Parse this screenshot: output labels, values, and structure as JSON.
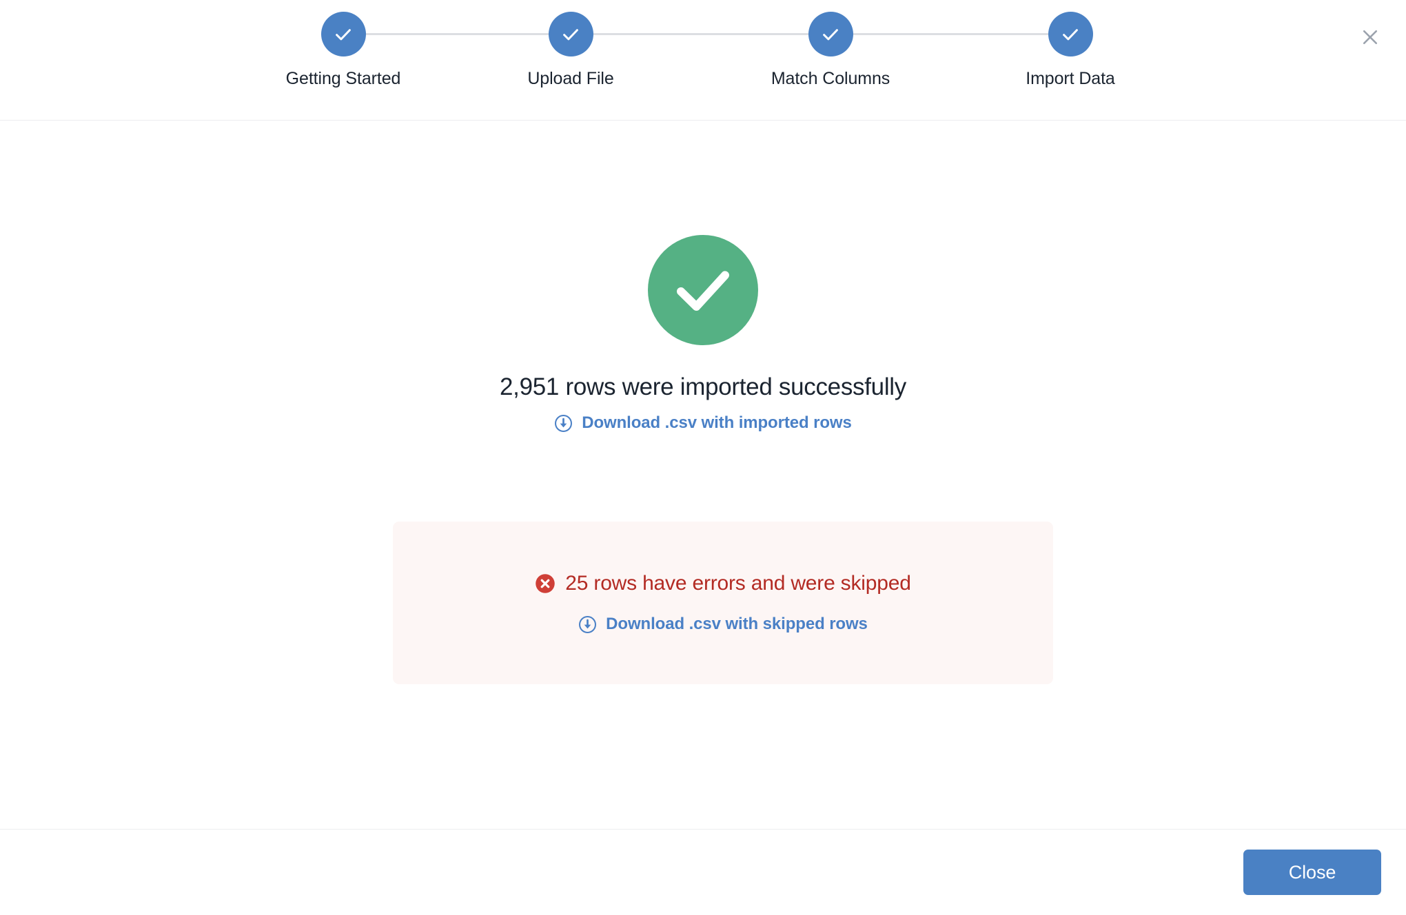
{
  "stepper": {
    "steps": [
      {
        "label": "Getting Started",
        "state": "complete",
        "icon": "check-icon"
      },
      {
        "label": "Upload File",
        "state": "complete",
        "icon": "check-icon"
      },
      {
        "label": "Match Columns",
        "state": "complete",
        "icon": "check-icon"
      },
      {
        "label": "Import Data",
        "state": "complete",
        "icon": "check-icon"
      }
    ],
    "active_color": "#4a81c4",
    "connector_color": "#dcdee2"
  },
  "header": {
    "close_icon": "close-x-icon",
    "close_icon_color": "#9ba2ad"
  },
  "result": {
    "status_icon": "check-circle-icon",
    "status_color": "#55b184",
    "title": "2,951 rows were imported successfully",
    "imported_rows": 2951,
    "download_link": {
      "icon": "download-circle-icon",
      "label": "Download .csv with imported rows",
      "color": "#4a80c6"
    }
  },
  "error_panel": {
    "background": "#fdf6f5",
    "icon": "error-circle-icon",
    "icon_color": "#cf3f37",
    "message": "25 rows have errors and were skipped",
    "skipped_rows": 25,
    "text_color": "#b32b24",
    "download_link": {
      "icon": "download-circle-icon",
      "label": "Download .csv with skipped rows",
      "color": "#4a80c6"
    }
  },
  "footer": {
    "close_button": {
      "label": "Close",
      "background": "#4a81c4",
      "text_color": "#ffffff"
    }
  }
}
